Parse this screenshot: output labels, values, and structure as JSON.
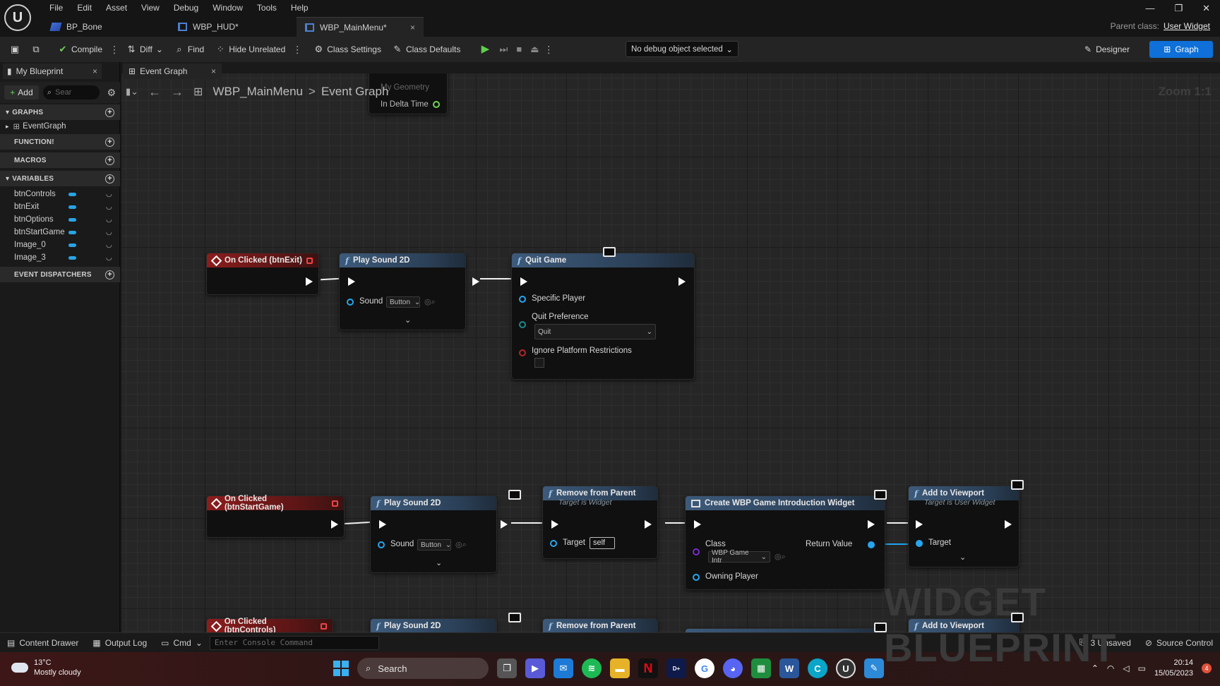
{
  "menu": [
    "File",
    "Edit",
    "Asset",
    "View",
    "Debug",
    "Window",
    "Tools",
    "Help"
  ],
  "doc_tabs": [
    {
      "label": "BP_Bone",
      "active": false
    },
    {
      "label": "WBP_HUD*",
      "active": false
    },
    {
      "label": "WBP_MainMenu*",
      "active": true,
      "close": "×"
    }
  ],
  "window_controls": {
    "minimize": "—",
    "restore": "❐",
    "close": "✕"
  },
  "parent_class": {
    "label": "Parent class:",
    "value": "User Widget"
  },
  "toolbar": {
    "compile": "Compile",
    "diff": "Diff",
    "find": "Find",
    "hide_unrelated": "Hide Unrelated",
    "class_settings": "Class Settings",
    "class_defaults": "Class Defaults",
    "debug_select": "No debug object selected",
    "designer": "Designer",
    "graph": "Graph"
  },
  "left_panel": {
    "tab": "My Blueprint",
    "tab_close": "×",
    "add": "Add",
    "search_placeholder": "Sear",
    "sections": {
      "graphs": "GRAPHS",
      "functions": "FUNCTION!",
      "macros": "MACROS",
      "variables": "VARIABLES",
      "dispatchers": "EVENT DISPATCHERS"
    },
    "graph_item": "EventGraph",
    "variables": [
      "btnControls",
      "btnExit",
      "btnOptions",
      "btnStartGame",
      "Image_0",
      "Image_3"
    ]
  },
  "graph_tab": {
    "label": "Event Graph",
    "close": "×"
  },
  "breadcrumb": {
    "root": "WBP_MainMenu",
    "sep": ">",
    "current": "Event Graph"
  },
  "zoom": "Zoom 1:1",
  "watermark": "WIDGET BLUEPRINT",
  "top_partial_node": {
    "pin1": "My Geometry",
    "pin2": "In Delta Time"
  },
  "nodes": {
    "ev_exit": "On Clicked (btnExit)",
    "ps1": "Play Sound 2D",
    "ps1_sound": "Sound",
    "ps1_value": "Button",
    "quit": "Quit Game",
    "quit_player": "Specific Player",
    "quit_pref": "Quit Preference",
    "quit_pref_value": "Quit",
    "quit_ignore": "Ignore Platform Restrictions",
    "ev_start": "On Clicked (btnStartGame)",
    "ps2": "Play Sound 2D",
    "ps2_sound": "Sound",
    "ps2_value": "Button",
    "rfp": "Remove from Parent",
    "rfp_sub": "Target is Widget",
    "rfp_target": "Target",
    "rfp_self": "self",
    "cw": "Create WBP Game Introduction Widget",
    "cw_class": "Class",
    "cw_class_value": "WBP Game Intr",
    "cw_return": "Return Value",
    "cw_owning": "Owning Player",
    "atv": "Add to Viewport",
    "atv_sub": "Target is User Widget",
    "atv_target": "Target",
    "ev_controls": "On Clicked (btnControls)",
    "ps3": "Play Sound 2D",
    "rfp2": "Remove from Parent",
    "atv2": "Add to Viewport"
  },
  "statusbar": {
    "content_drawer": "Content Drawer",
    "output_log": "Output Log",
    "cmd": "Cmd",
    "console_placeholder": "Enter Console Command",
    "unsaved": "3 Unsaved",
    "source_control": "Source Control"
  },
  "taskbar": {
    "temp": "13°C",
    "weather": "Mostly cloudy",
    "search": "Search",
    "time": "20:14",
    "date": "15/05/2023",
    "notif": "4"
  }
}
